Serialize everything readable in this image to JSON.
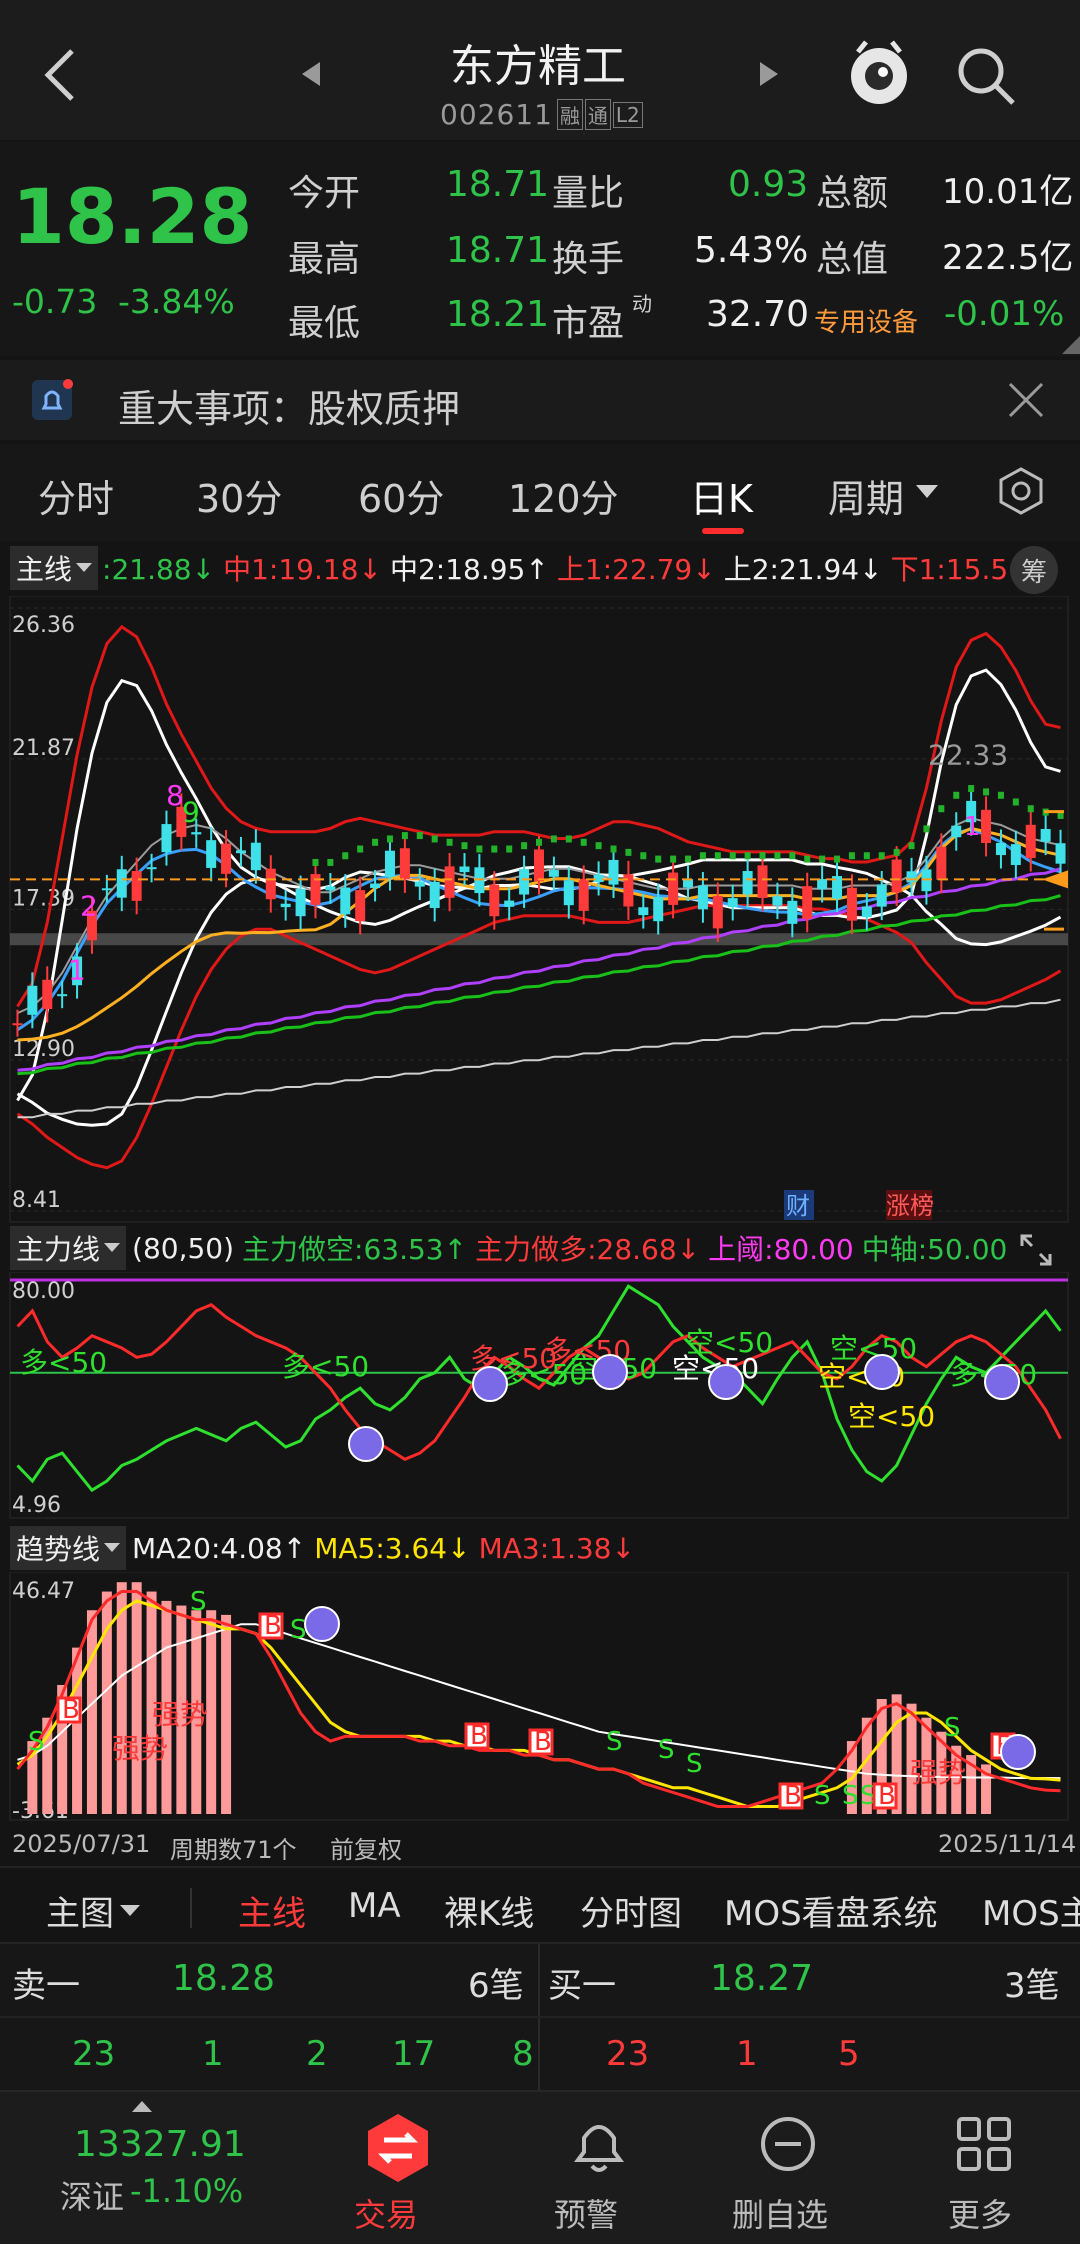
{
  "header": {
    "title": "东方精工",
    "code": "002611",
    "badges": [
      "融",
      "通",
      "L2"
    ]
  },
  "quote": {
    "price": "18.28",
    "change": "-0.73",
    "change_pct": "-3.84%",
    "rows": [
      {
        "l1": "今开",
        "v1": "18.71",
        "l2": "量比",
        "v2": "0.93",
        "l3": "总额",
        "v3": "10.01亿"
      },
      {
        "l1": "最高",
        "v1": "18.71",
        "l2": "换手",
        "v2": "5.43%",
        "l3": "总值",
        "v3": "222.5亿"
      },
      {
        "l1": "最低",
        "v1": "18.21",
        "l2": "市盈",
        "l2sup": "动",
        "v2": "32.70",
        "l3": "专用设备",
        "v3": "-0.01%"
      }
    ]
  },
  "notice": {
    "text": "重大事项：股权质押"
  },
  "period_tabs": [
    "分时",
    "30分",
    "60分",
    "120分",
    "日K",
    "周期"
  ],
  "main_chart": {
    "indicator": "主线",
    "legend": [
      {
        "t": ":21.88",
        "c": "g",
        "a": "↓"
      },
      {
        "t": "中1:19.18",
        "c": "r",
        "a": "↓"
      },
      {
        "t": "中2:18.95",
        "c": "w",
        "a": "↑"
      },
      {
        "t": "上1:22.79",
        "c": "r",
        "a": "↓"
      },
      {
        "t": "上2:21.94",
        "c": "w",
        "a": "↓"
      },
      {
        "t": "下1:15.56",
        "c": "r",
        "a": "↑"
      }
    ],
    "chip_button": "筹",
    "y_labels": [
      "26.36",
      "21.87",
      "17.39",
      "12.90",
      "8.41"
    ],
    "annotations": [
      "1",
      "2",
      "8",
      "9",
      "22.33",
      "1"
    ],
    "event_tags": [
      "财",
      "涨榜"
    ]
  },
  "chart_data": [
    {
      "type": "line",
      "title": "主线",
      "ylim": [
        8.41,
        26.36
      ],
      "x": [
        1,
        2,
        3,
        4,
        5,
        6,
        7,
        8,
        9,
        10,
        11,
        12,
        13,
        14,
        15,
        16,
        17,
        18,
        19,
        20,
        21,
        22,
        23,
        24,
        25,
        26,
        27,
        28,
        29,
        30,
        31,
        32,
        33,
        34,
        35,
        36,
        37,
        38,
        39,
        40,
        41,
        42,
        43,
        44,
        45,
        46,
        47,
        48,
        49,
        50,
        51,
        52,
        53,
        54,
        55,
        56,
        57,
        58,
        59,
        60,
        61,
        62,
        63,
        64,
        65,
        66,
        67,
        68,
        69,
        70,
        71
      ],
      "series": [
        {
          "name": "上1",
          "values": [
            14.5,
            15.2,
            17.0,
            19.5,
            22.0,
            24.0,
            25.3,
            25.8,
            25.5,
            24.6,
            23.5,
            22.6,
            21.8,
            21.0,
            20.4,
            20.0,
            19.8,
            19.7,
            19.7,
            19.7,
            19.7,
            19.8,
            20.0,
            20.1,
            20.0,
            19.9,
            19.8,
            19.7,
            19.6,
            19.6,
            19.6,
            19.6,
            19.7,
            19.7,
            19.7,
            19.6,
            19.5,
            19.5,
            19.6,
            19.8,
            20.0,
            20.0,
            19.9,
            19.8,
            19.6,
            19.4,
            19.3,
            19.2,
            19.1,
            19.1,
            19.1,
            19.1,
            19.1,
            19.0,
            18.9,
            18.9,
            18.8,
            18.8,
            18.9,
            19.0,
            19.4,
            21.0,
            23.0,
            24.6,
            25.4,
            25.6,
            25.2,
            24.5,
            23.6,
            22.9,
            22.8
          ]
        },
        {
          "name": "下1",
          "values": [
            11.3,
            11.0,
            10.6,
            10.3,
            10.0,
            9.8,
            9.7,
            9.9,
            10.6,
            11.6,
            12.7,
            13.8,
            14.8,
            15.6,
            16.2,
            16.6,
            16.8,
            16.8,
            16.6,
            16.4,
            16.2,
            16.0,
            15.8,
            15.6,
            15.5,
            15.6,
            15.8,
            16.0,
            16.2,
            16.4,
            16.6,
            16.8,
            17.0,
            17.1,
            17.2,
            17.2,
            17.2,
            17.2,
            17.1,
            17.0,
            17.0,
            17.0,
            17.1,
            17.2,
            17.3,
            17.4,
            17.5,
            17.5,
            17.5,
            17.5,
            17.5,
            17.5,
            17.5,
            17.4,
            17.4,
            17.3,
            17.2,
            17.1,
            16.9,
            16.7,
            16.4,
            15.8,
            15.3,
            14.8,
            14.6,
            14.6,
            14.7,
            14.9,
            15.1,
            15.3,
            15.56
          ]
        },
        {
          "name": "MA5",
          "values": [
            14.0,
            14.2,
            14.6,
            15.2,
            16.0,
            16.8,
            17.5,
            18.0,
            18.5,
            19.0,
            19.3,
            19.5,
            19.6,
            19.5,
            19.2,
            18.8,
            18.5,
            18.2,
            18.0,
            17.8,
            17.6,
            17.6,
            17.8,
            18.0,
            18.2,
            18.3,
            18.4,
            18.4,
            18.3,
            18.2,
            18.1,
            18.0,
            18.0,
            18.0,
            18.1,
            18.2,
            18.3,
            18.3,
            18.2,
            18.1,
            18.0,
            17.9,
            17.8,
            17.7,
            17.7,
            17.7,
            17.8,
            17.8,
            17.8,
            17.8,
            17.8,
            17.8,
            17.8,
            17.7,
            17.7,
            17.7,
            17.8,
            17.8,
            17.8,
            17.9,
            18.1,
            18.6,
            19.2,
            19.6,
            19.8,
            19.7,
            19.6,
            19.4,
            19.2,
            19.1,
            19.0
          ]
        },
        {
          "name": "MA60",
          "values": [
            12.8,
            12.8,
            12.9,
            12.9,
            13.0,
            13.0,
            13.1,
            13.1,
            13.2,
            13.2,
            13.3,
            13.3,
            13.4,
            13.4,
            13.5,
            13.5,
            13.6,
            13.6,
            13.7,
            13.7,
            13.8,
            13.8,
            13.9,
            13.9,
            14.0,
            14.0,
            14.1,
            14.1,
            14.2,
            14.2,
            14.3,
            14.3,
            14.4,
            14.4,
            14.5,
            14.5,
            14.6,
            14.6,
            14.7,
            14.7,
            14.8,
            14.8,
            14.9,
            14.9,
            15.0,
            15.0,
            15.1,
            15.1,
            15.2,
            15.2,
            15.3,
            15.3,
            15.4,
            15.4,
            15.5,
            15.5,
            15.6,
            15.6,
            15.7,
            15.7,
            15.8,
            15.8,
            15.9,
            15.9,
            16.0,
            16.0,
            16.1,
            16.1,
            16.2,
            16.2,
            16.3
          ]
        }
      ]
    },
    {
      "type": "line",
      "title": "主力线",
      "ylim": [
        4.96,
        80.0
      ],
      "series": [
        {
          "name": "主力做空",
          "values": [
            20,
            15,
            22,
            24,
            18,
            12,
            15,
            20,
            22,
            25,
            28,
            30,
            32,
            30,
            28,
            32,
            34,
            30,
            26,
            28,
            35,
            38,
            42,
            45,
            40,
            38,
            42,
            48,
            50,
            55,
            48,
            45,
            50,
            55,
            52,
            48,
            46,
            52,
            58,
            62,
            70,
            78,
            75,
            72,
            65,
            60,
            55,
            52,
            50,
            45,
            40,
            48,
            55,
            60,
            50,
            35,
            25,
            18,
            15,
            20,
            30,
            40,
            48,
            55,
            52,
            50,
            55,
            60,
            65,
            70,
            63.53
          ]
        },
        {
          "name": "主力做多",
          "values": [
            65,
            70,
            60,
            55,
            58,
            62,
            60,
            58,
            55,
            56,
            60,
            65,
            70,
            72,
            68,
            65,
            62,
            60,
            58,
            55,
            50,
            45,
            38,
            32,
            28,
            25,
            22,
            24,
            28,
            35,
            42,
            50,
            55,
            52,
            48,
            45,
            50,
            55,
            58,
            55,
            52,
            48,
            50,
            55,
            60,
            62,
            58,
            55,
            52,
            54,
            56,
            58,
            60,
            55,
            50,
            48,
            52,
            58,
            62,
            60,
            55,
            52,
            56,
            60,
            62,
            60,
            56,
            52,
            45,
            38,
            28.68
          ]
        }
      ]
    },
    {
      "type": "line",
      "title": "趋势线",
      "ylim": [
        -3.61,
        46.47
      ],
      "series": [
        {
          "name": "MA20",
          "values": [
            8,
            9,
            11,
            14,
            17,
            20,
            23,
            26,
            28,
            30,
            32,
            33,
            34,
            35,
            36,
            37,
            37,
            36,
            35,
            34,
            33,
            32,
            31,
            30,
            29,
            28,
            27,
            26,
            25,
            24,
            23,
            22,
            21,
            20,
            19,
            18,
            17,
            16,
            15,
            14,
            13.5,
            13,
            12.5,
            12,
            11.5,
            11,
            10.5,
            10,
            9.5,
            9,
            8.5,
            8,
            7.5,
            7,
            6.5,
            6,
            5.5,
            5,
            4.8,
            4.6,
            4.5,
            4.4,
            4.3,
            4.3,
            4.2,
            4.2,
            4.2,
            4.1,
            4.1,
            4.1,
            4.08
          ]
        },
        {
          "name": "MA5",
          "values": [
            7,
            9,
            13,
            18,
            24,
            30,
            36,
            40,
            42,
            41,
            40,
            39,
            38,
            37,
            36,
            36,
            35,
            32,
            28,
            24,
            20,
            16,
            14,
            13,
            13,
            13,
            13,
            13,
            12,
            12,
            11,
            11,
            10,
            10,
            10,
            9,
            8,
            8,
            7,
            6,
            6,
            5,
            4,
            3,
            2,
            2,
            1,
            0,
            -1,
            -2,
            -2,
            -2,
            -1,
            0,
            1,
            2,
            4,
            8,
            12,
            16,
            18,
            18,
            16,
            13,
            10,
            8,
            6,
            5,
            4,
            3.9,
            3.64
          ]
        },
        {
          "name": "MA3",
          "values": [
            6,
            10,
            15,
            22,
            30,
            38,
            42,
            44,
            44,
            42,
            40,
            39,
            38,
            38,
            37,
            36,
            35,
            30,
            24,
            18,
            14,
            12,
            13,
            13,
            13,
            13,
            13,
            12,
            12,
            11,
            11,
            10,
            10,
            10,
            9,
            9,
            8,
            8,
            7,
            6,
            6,
            5,
            3,
            2,
            1,
            0,
            -1,
            -2,
            -2,
            -2,
            -1,
            0,
            1,
            2,
            3,
            6,
            10,
            15,
            19,
            20,
            18,
            15,
            12,
            9,
            7,
            5,
            4,
            3,
            2,
            1.5,
            1.38
          ]
        }
      ]
    }
  ],
  "sub_chart1": {
    "indicator": "主力线",
    "param": "(80,50)",
    "legend": [
      {
        "t": "主力做空:63.53",
        "c": "g",
        "a": "↑"
      },
      {
        "t": "主力做多:28.68",
        "c": "r",
        "a": "↓"
      },
      {
        "t": "上阈:80.00",
        "c": "m",
        "a": ""
      },
      {
        "t": "中轴:50.00",
        "c": "g",
        "a": ""
      }
    ],
    "y_labels": [
      "80.00",
      "4.96"
    ],
    "labels": [
      "多<50",
      "多<50",
      "多<50",
      "多<50",
      "多<50",
      "空<50",
      "空<50",
      "空<50",
      "空<50",
      "空<50",
      "空<50",
      "多<50"
    ]
  },
  "sub_chart2": {
    "indicator": "趋势线",
    "legend": [
      {
        "t": "MA20:4.08",
        "c": "w",
        "a": "↑"
      },
      {
        "t": "MA5:3.64",
        "c": "y",
        "a": "↓"
      },
      {
        "t": "MA3:1.38",
        "c": "r",
        "a": "↓"
      }
    ],
    "y_labels": [
      "46.47",
      "-3.61"
    ],
    "labels": [
      "强势",
      "强势",
      "强势"
    ],
    "markers": [
      "S",
      "B",
      "S",
      "B",
      "S",
      "B",
      "B",
      "S",
      "S",
      "S",
      "B",
      "S",
      "S",
      "S",
      "B",
      "B",
      "S"
    ]
  },
  "date_bar": {
    "start": "2025/07/31",
    "count": "周期数71个",
    "adj": "前复权",
    "end": "2025/11/14"
  },
  "indicator_tabs": {
    "main": "主图",
    "items": [
      "主线",
      "MA",
      "裸K线",
      "分时图",
      "MOS看盘系统",
      "MOS主"
    ]
  },
  "order_book": {
    "sell": {
      "label": "卖一",
      "price": "18.28",
      "count": "6笔",
      "vols": [
        "23",
        "1",
        "2",
        "17",
        "8"
      ]
    },
    "buy": {
      "label": "买一",
      "price": "18.27",
      "count": "3笔",
      "vols": [
        "23",
        "1",
        "5"
      ]
    }
  },
  "bottom_nav": {
    "index_value": "13327.91",
    "index_name": "深证",
    "index_change": "-1.10%",
    "items": [
      "交易",
      "预警",
      "删自选",
      "更多"
    ]
  }
}
